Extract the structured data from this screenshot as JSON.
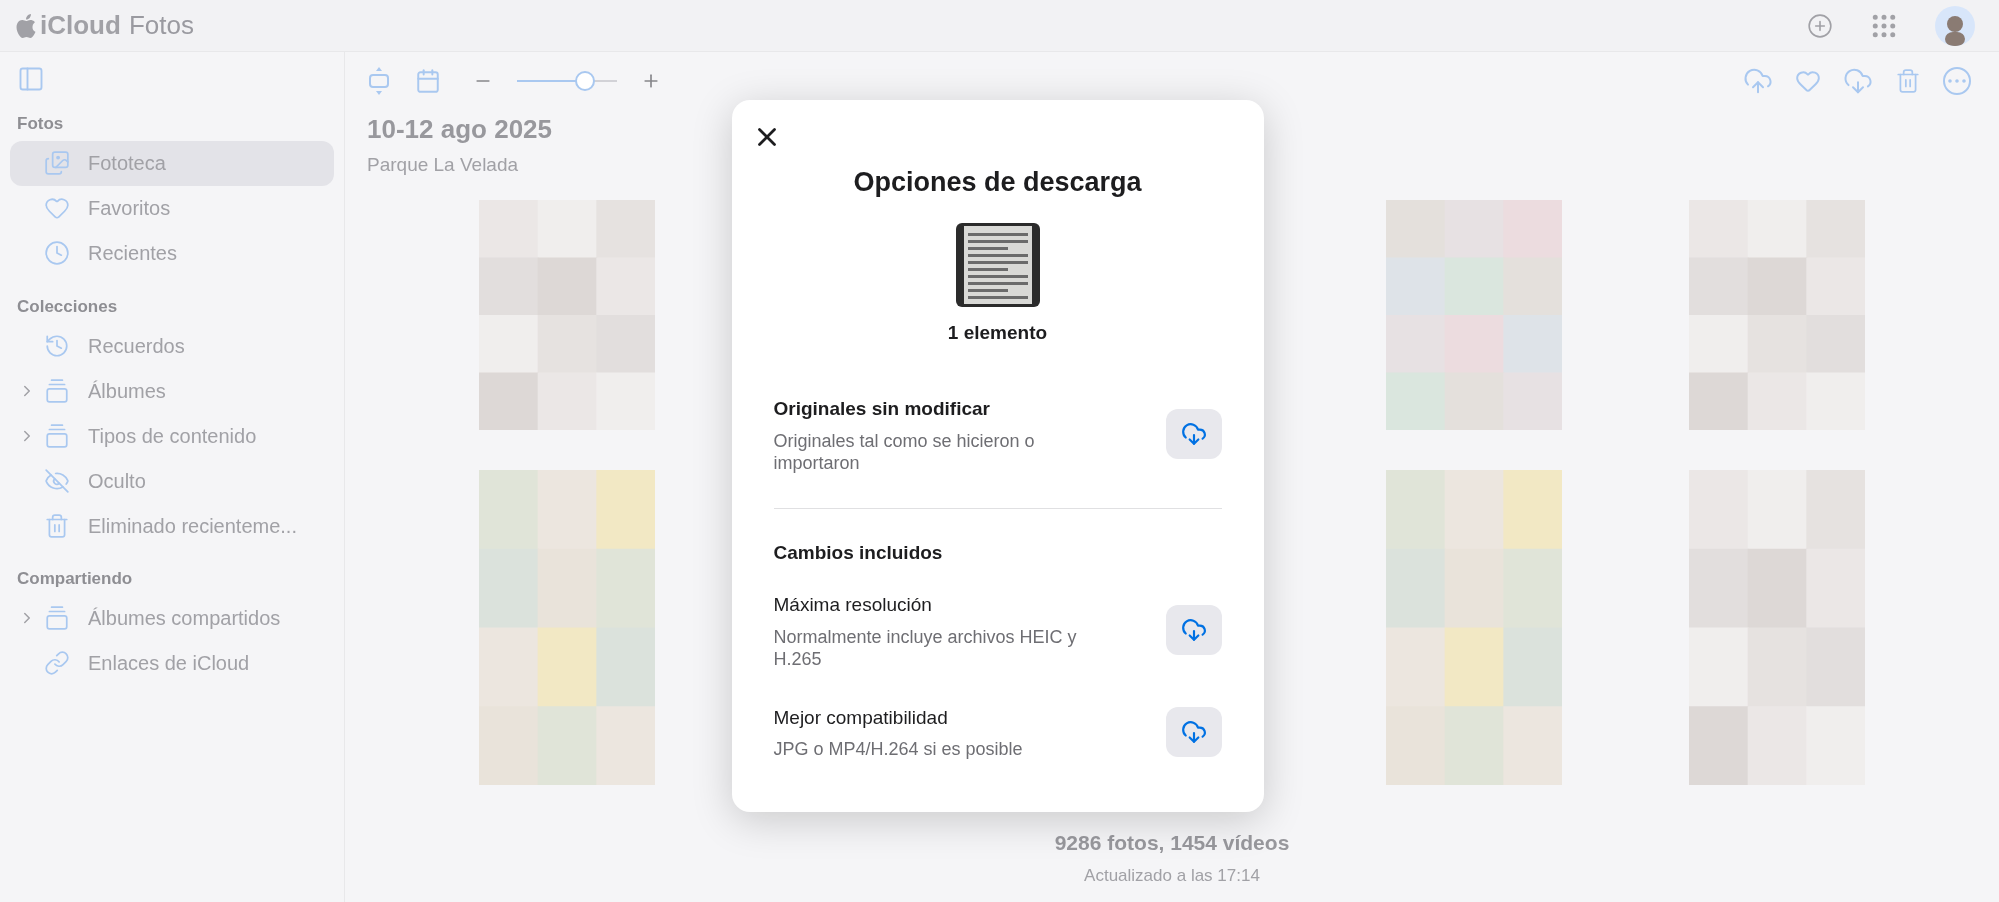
{
  "header": {
    "brand": "iCloud",
    "app": "Fotos"
  },
  "sidebar": {
    "sections": [
      {
        "title": "Fotos",
        "items": [
          {
            "label": "Fototeca",
            "selected": true,
            "expandable": false
          },
          {
            "label": "Favoritos",
            "selected": false,
            "expandable": false
          },
          {
            "label": "Recientes",
            "selected": false,
            "expandable": false
          }
        ]
      },
      {
        "title": "Colecciones",
        "items": [
          {
            "label": "Recuerdos",
            "selected": false,
            "expandable": false
          },
          {
            "label": "Álbumes",
            "selected": false,
            "expandable": true
          },
          {
            "label": "Tipos de contenido",
            "selected": false,
            "expandable": true
          },
          {
            "label": "Oculto",
            "selected": false,
            "expandable": false
          },
          {
            "label": "Eliminado recienteme...",
            "selected": false,
            "expandable": false
          }
        ]
      },
      {
        "title": "Compartiendo",
        "items": [
          {
            "label": "Álbumes compartidos",
            "selected": false,
            "expandable": true
          },
          {
            "label": "Enlaces de iCloud",
            "selected": false,
            "expandable": false
          }
        ]
      }
    ]
  },
  "toolbar": {
    "zoom": {
      "level": 0.68
    }
  },
  "library": {
    "date": "10-12 ago 2025",
    "place": "Parque La Velada",
    "count": "9286 fotos, 1454 vídeos",
    "updated": "Actualizado a las 17:14"
  },
  "dialog": {
    "title": "Opciones de descarga",
    "item_count": "1 elemento",
    "sections": [
      {
        "options": [
          {
            "kind": "primary",
            "title": "Originales sin modificar",
            "description": "Originales tal como se hicieron o importaron"
          }
        ]
      },
      {
        "heading": "Cambios incluidos",
        "options": [
          {
            "kind": "standard",
            "title": "Máxima resolución",
            "description": "Normalmente incluye archivos HEIC y H.265"
          },
          {
            "kind": "standard",
            "title": "Mejor compatibilidad",
            "description": "JPG o MP4/H.264 si es posible"
          }
        ]
      }
    ]
  }
}
